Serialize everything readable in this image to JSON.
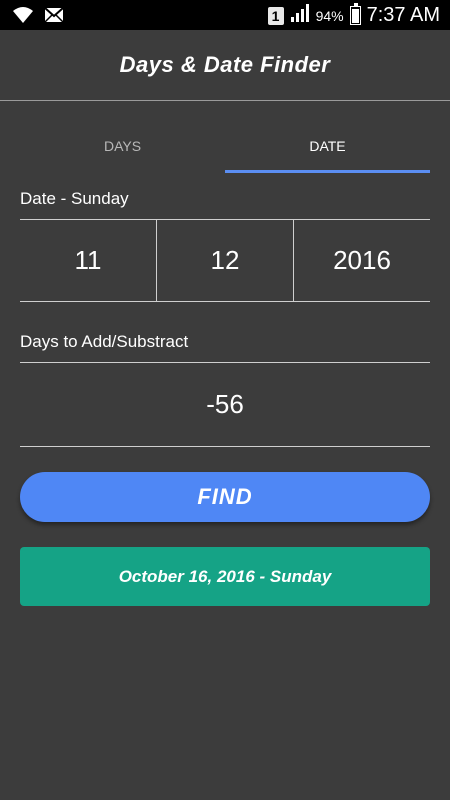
{
  "status_bar": {
    "sim_slot": "1",
    "battery_percent": "94%",
    "battery_level": 0.94,
    "time": "7:37 AM",
    "icons": [
      "wifi-icon",
      "mail-icon",
      "signal-icon",
      "battery-icon"
    ]
  },
  "app": {
    "title": "Days & Date Finder"
  },
  "tabs": [
    {
      "label": "DAYS",
      "active": false
    },
    {
      "label": "DATE",
      "active": true
    }
  ],
  "date_section": {
    "label": "Date - Sunday",
    "day": "11",
    "month": "12",
    "year": "2016"
  },
  "days_section": {
    "label": "Days to Add/Substract",
    "value": "-56"
  },
  "find_button": {
    "label": "FIND"
  },
  "result": {
    "text": "October 16, 2016 - Sunday"
  },
  "colors": {
    "background": "#3c3c3c",
    "accent": "#5b8ef2",
    "button": "#4f87f5",
    "result_bg": "#15a386"
  }
}
